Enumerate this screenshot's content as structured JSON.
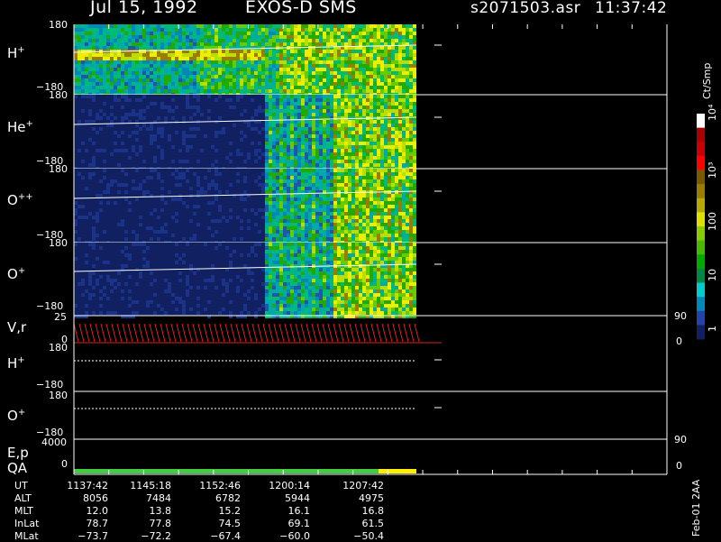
{
  "header": {
    "date": "Jul 15, 1992",
    "instrument": "EXOS-D SMS",
    "file": "s2071503.asr",
    "time": "11:37:42"
  },
  "panels": [
    {
      "id": "h",
      "label": "H",
      "sup": "+",
      "top_tick": "180",
      "bot_tick": "−180"
    },
    {
      "id": "he",
      "label": "He",
      "sup": "+",
      "top_tick": "180",
      "bot_tick": "−180"
    },
    {
      "id": "opp",
      "label": "O",
      "sup": "++",
      "top_tick": "180",
      "bot_tick": "−180"
    },
    {
      "id": "o",
      "label": "O",
      "sup": "+",
      "top_tick": "180",
      "bot_tick": "−180"
    }
  ],
  "vr_panel": {
    "label": "V,r",
    "left_top": "25",
    "left_bot": "0",
    "right_top": "90",
    "right_bot": "0"
  },
  "angle_panels": [
    {
      "label": "H",
      "sup": "+",
      "top_tick": "180",
      "bot_tick": "−180"
    },
    {
      "label": "O",
      "sup": "+",
      "top_tick": "180",
      "bot_tick": "−180"
    }
  ],
  "ep_panel": {
    "label1": "E,p",
    "label2": "QA",
    "left_top": "4000",
    "left_bot": "0",
    "right_top": "90",
    "right_bot": "0"
  },
  "colorbar": {
    "title": "Ct/Smp",
    "ticks": [
      "10⁴",
      "10³",
      "100",
      "10",
      "1"
    ],
    "colors": [
      "#ffffff",
      "#aa0000",
      "#cc0000",
      "#ff0000",
      "#7a5a00",
      "#9b7b00",
      "#b7a800",
      "#e0e000",
      "#88cc00",
      "#44bb00",
      "#00aa00",
      "#008844",
      "#00cccc",
      "#0088bb",
      "#2244aa",
      "#102060"
    ]
  },
  "footer": {
    "labels": [
      "UT",
      "ALT",
      "MLT",
      "InLat",
      "MLat"
    ],
    "columns": [
      [
        "1137:42",
        "8056",
        "12.0",
        "78.7",
        "−73.7"
      ],
      [
        "1145:18",
        "7484",
        "13.8",
        "77.8",
        "−72.2"
      ],
      [
        "1152:46",
        "6782",
        "15.2",
        "74.5",
        "−67.4"
      ],
      [
        "1200:14",
        "5944",
        "16.1",
        "69.1",
        "−60.0"
      ],
      [
        "1207:42",
        "4975",
        "16.8",
        "61.5",
        "−50.4"
      ]
    ],
    "side_note": "Feb-01 2AA"
  },
  "chart_data": {
    "type": "heatmap",
    "title": "Jul 15, 1992   EXOS-D SMS",
    "x_ticks": [
      "1137:42",
      "1145:18",
      "1152:46",
      "1200:14",
      "1207:42"
    ],
    "panels": [
      "H+",
      "He+",
      "O++",
      "O+",
      "V,r",
      "H+",
      "O+",
      "E,p",
      "QA"
    ],
    "ylim": [
      -180,
      180
    ],
    "colorbar_ticks": [
      "1",
      "10",
      "100",
      "10^3",
      "10^4"
    ],
    "qa_segments": [
      {
        "color": "#44cc44",
        "from": "1137:42",
        "to": "1207:42"
      },
      {
        "color": "#ffee00",
        "from": "1207:42",
        "to": "end"
      }
    ]
  }
}
